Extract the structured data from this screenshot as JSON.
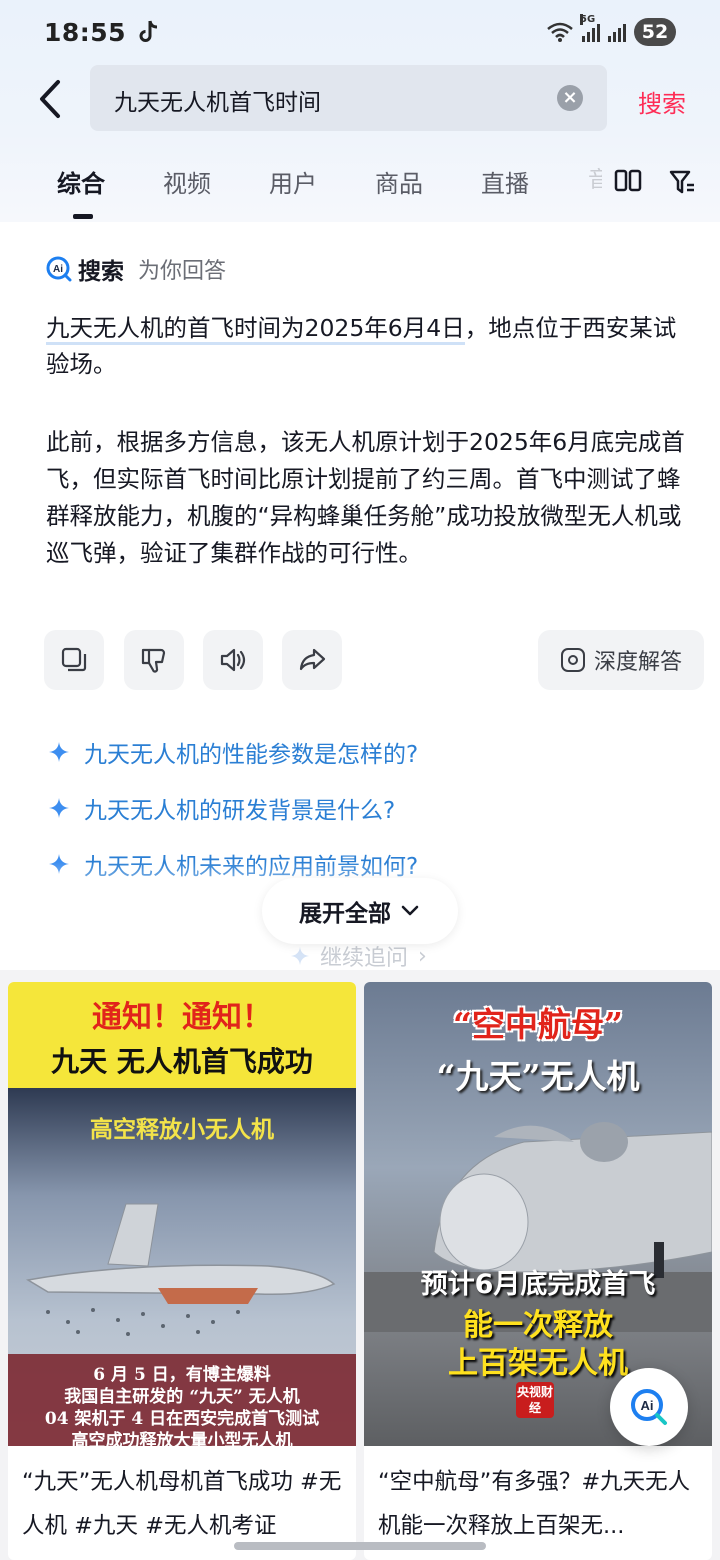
{
  "status": {
    "time": "18:55",
    "battery": "52",
    "network_tag": "5G",
    "wifi_tag": "6"
  },
  "search": {
    "query": "九天无人机首飞时间",
    "submit_label": "搜索"
  },
  "tabs": [
    "综合",
    "视频",
    "用户",
    "商品",
    "直播"
  ],
  "tab_overflow": "音",
  "ai_answer": {
    "brand": "搜索",
    "subtitle": "为你回答",
    "highlight": "九天无人机的首飞时间为2025年6月4日",
    "para1_rest": "，地点位于西安某试验场。",
    "para2": "此前，根据多方信息，该无人机原计划于2025年6月底完成首飞，但实际首飞时间比原计划提前了约三周。首飞中测试了蜂群释放能力，机腹的“异构蜂巢任务舱”成功投放微型无人机或巡飞弹，验证了集群作战的可行性。",
    "deep_label": "深度解答",
    "followups": [
      "九天无人机的性能参数是怎样的?",
      "九天无人机的研发背景是什么?",
      "九天无人机未来的应用前景如何?"
    ],
    "expand_label": "展开全部",
    "continue_label": "继续追问"
  },
  "results": [
    {
      "thumb_line1": "通知！通知！",
      "thumb_line2": "九天 无人机首飞成功",
      "thumb_banner": "高空释放小无人机",
      "thumb_caption": [
        "6 月 5 日，有博主爆料",
        "我国自主研发的 “九天” 无人机",
        "04 架机于 4 日在西安完成首飞测试",
        "高空成功释放大量小型无人机"
      ],
      "title": "“九天”无人机母机首飞成功 #无人机 #九天 #无人机考证"
    },
    {
      "thumb_line1": "“空中航母”",
      "thumb_line2": "“九天”无人机",
      "thumb_line3": "预计6月底完成首飞",
      "thumb_line4": "能一次释放",
      "thumb_line5": "上百架无人机",
      "thumb_badge": "央视财经",
      "title": "“空中航母”有多强？#九天无人机能一次释放上百架无..."
    }
  ],
  "colors": {
    "accent": "#fe2c55",
    "link": "#2b7fd4",
    "text": "#161823"
  }
}
